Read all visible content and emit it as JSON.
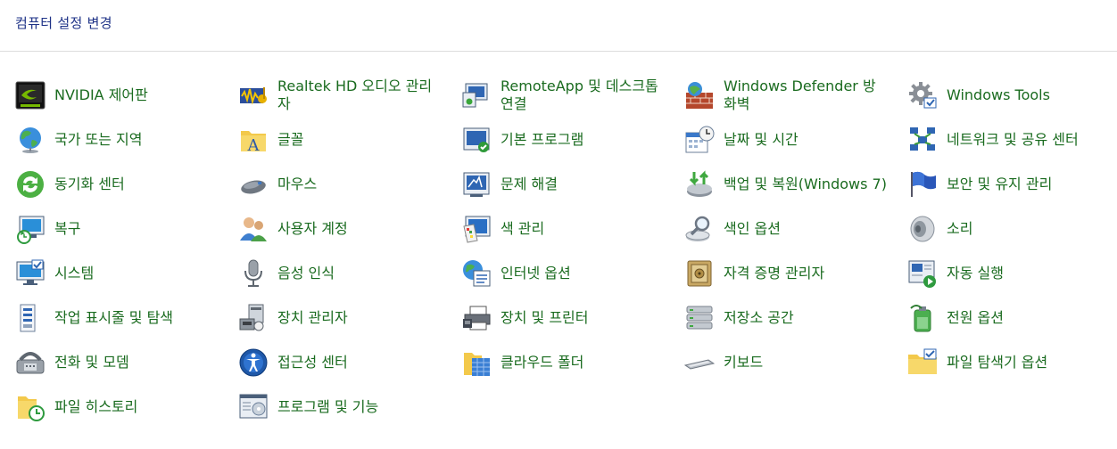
{
  "header": {
    "title": "컴퓨터 설정 변경"
  },
  "items": [
    {
      "label": "NVIDIA 제어판",
      "icon": "nvidia-icon"
    },
    {
      "label": "Realtek HD 오디오 관리자",
      "icon": "realtek-audio-icon"
    },
    {
      "label": "RemoteApp 및 데스크톱 연결",
      "icon": "remote-desktop-icon"
    },
    {
      "label": "Windows Defender 방화벽",
      "icon": "firewall-icon"
    },
    {
      "label": "Windows Tools",
      "icon": "gear-icon"
    },
    {
      "label": "국가 또는 지역",
      "icon": "globe-icon"
    },
    {
      "label": "글꼴",
      "icon": "font-folder-icon"
    },
    {
      "label": "기본 프로그램",
      "icon": "default-programs-icon"
    },
    {
      "label": "날짜 및 시간",
      "icon": "calendar-clock-icon"
    },
    {
      "label": "네트워크 및 공유 센터",
      "icon": "network-icon"
    },
    {
      "label": "동기화 센터",
      "icon": "sync-icon"
    },
    {
      "label": "마우스",
      "icon": "mouse-icon"
    },
    {
      "label": "문제 해결",
      "icon": "troubleshoot-icon"
    },
    {
      "label": "백업 및 복원(Windows 7)",
      "icon": "backup-icon"
    },
    {
      "label": "보안 및 유지 관리",
      "icon": "flag-icon"
    },
    {
      "label": "복구",
      "icon": "recovery-icon"
    },
    {
      "label": "사용자 계정",
      "icon": "user-accounts-icon"
    },
    {
      "label": "색 관리",
      "icon": "color-management-icon"
    },
    {
      "label": "색인 옵션",
      "icon": "indexing-icon"
    },
    {
      "label": "소리",
      "icon": "speaker-icon"
    },
    {
      "label": "시스템",
      "icon": "system-icon"
    },
    {
      "label": "음성 인식",
      "icon": "microphone-icon"
    },
    {
      "label": "인터넷 옵션",
      "icon": "internet-options-icon"
    },
    {
      "label": "자격 증명 관리자",
      "icon": "credential-vault-icon"
    },
    {
      "label": "자동 실행",
      "icon": "autoplay-icon"
    },
    {
      "label": "작업 표시줄 및 탐색",
      "icon": "taskbar-icon"
    },
    {
      "label": "장치 관리자",
      "icon": "device-manager-icon"
    },
    {
      "label": "장치 및 프린터",
      "icon": "printer-icon"
    },
    {
      "label": "저장소 공간",
      "icon": "storage-icon"
    },
    {
      "label": "전원 옵션",
      "icon": "power-icon"
    },
    {
      "label": "전화 및 모뎀",
      "icon": "phone-modem-icon"
    },
    {
      "label": "접근성 센터",
      "icon": "accessibility-icon"
    },
    {
      "label": "클라우드 폴더",
      "icon": "cloud-folder-icon"
    },
    {
      "label": "키보드",
      "icon": "keyboard-icon"
    },
    {
      "label": "파일 탐색기 옵션",
      "icon": "folder-options-icon"
    },
    {
      "label": "파일 히스토리",
      "icon": "file-history-icon"
    },
    {
      "label": "프로그램 및 기능",
      "icon": "programs-features-icon"
    }
  ]
}
